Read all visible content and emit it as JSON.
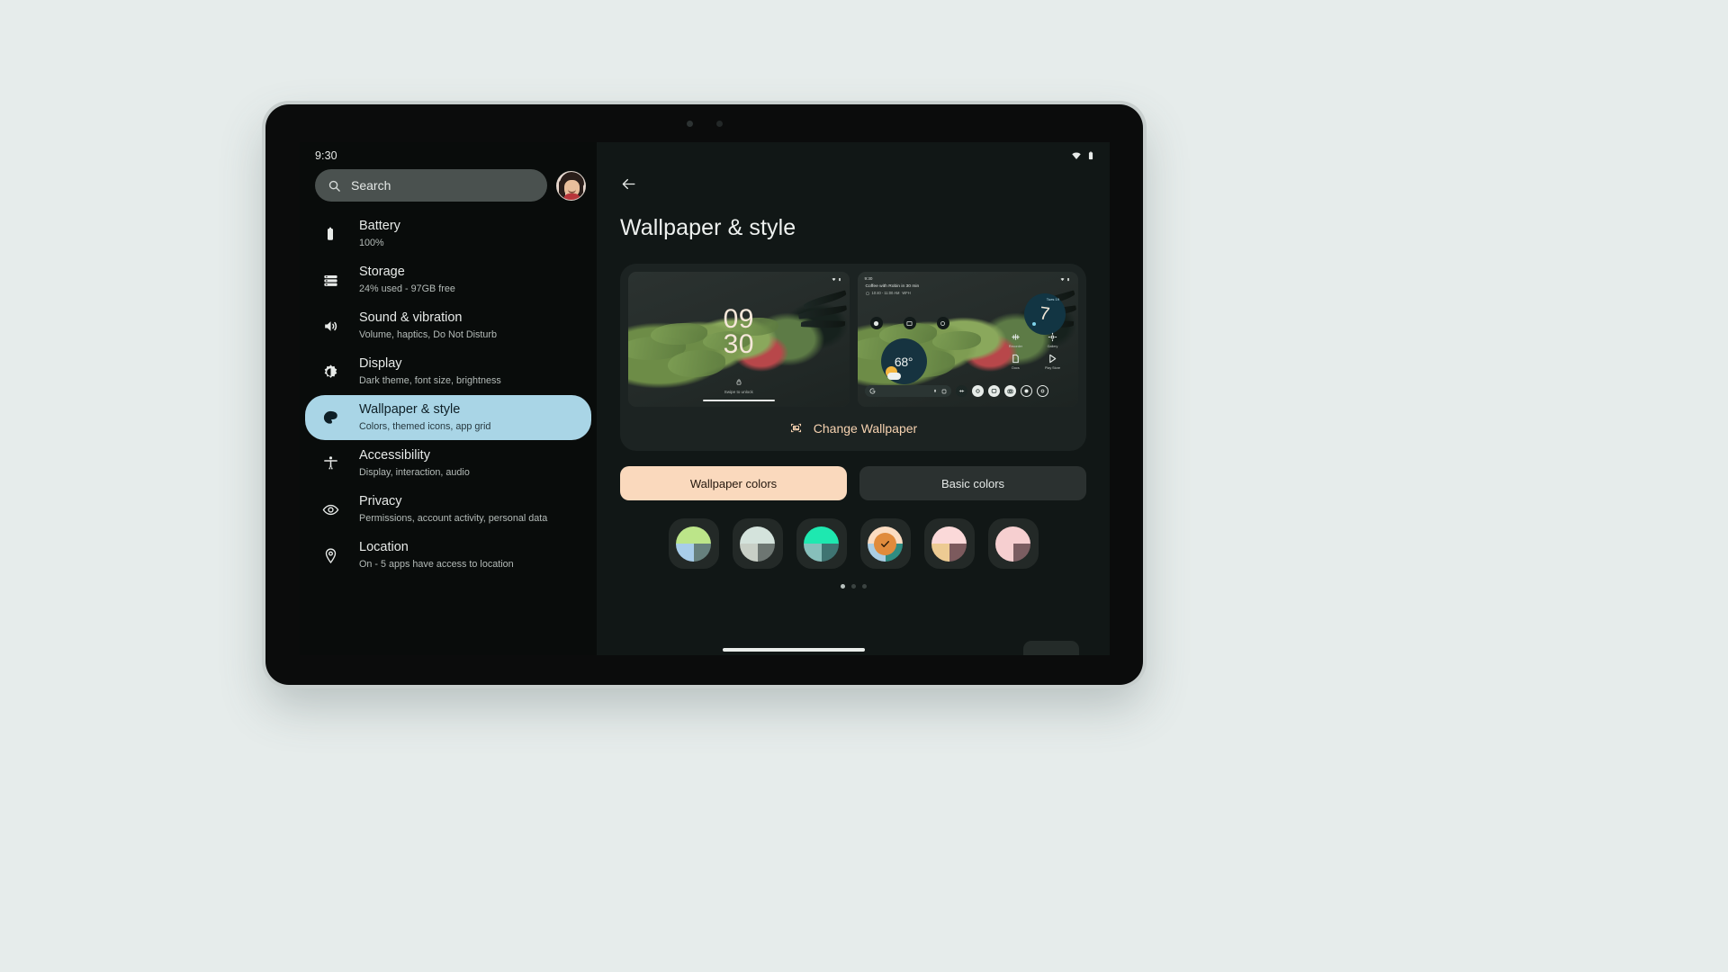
{
  "device": {
    "type": "tablet"
  },
  "status_bar": {
    "time": "9:30",
    "wifi_icon": "wifi-icon",
    "battery_icon": "battery-icon"
  },
  "sidebar": {
    "search": {
      "placeholder": "Search",
      "icon": "search-icon"
    },
    "avatar": {
      "name": "user-avatar"
    },
    "items": [
      {
        "icon": "battery-icon",
        "label": "Battery",
        "summary": "100%"
      },
      {
        "icon": "storage-icon",
        "label": "Storage",
        "summary": "24% used - 97GB free"
      },
      {
        "icon": "sound-icon",
        "label": "Sound & vibration",
        "summary": "Volume, haptics, Do Not Disturb"
      },
      {
        "icon": "brightness-icon",
        "label": "Display",
        "summary": "Dark theme, font size, brightness"
      },
      {
        "icon": "palette-icon",
        "label": "Wallpaper & style",
        "summary": "Colors, themed icons, app grid",
        "selected": true
      },
      {
        "icon": "accessibility-icon",
        "label": "Accessibility",
        "summary": "Display, interaction, audio"
      },
      {
        "icon": "privacy-icon",
        "label": "Privacy",
        "summary": "Permissions, account activity, personal data"
      },
      {
        "icon": "location-icon",
        "label": "Location",
        "summary": "On - 5 apps have access to location"
      }
    ]
  },
  "main": {
    "back_icon": "back-arrow-icon",
    "title": "Wallpaper & style",
    "previews": {
      "lock": {
        "name": "lock-screen-preview",
        "time_hh": "09",
        "time_mm": "30",
        "hint": "Swipe to unlock"
      },
      "home": {
        "name": "home-screen-preview",
        "clock": "9:30",
        "notification_title": "Coffee with Robin in 30 min",
        "notification_sub": "10:40 - 11:00 AM",
        "notification_sub2": "WFH",
        "weather_temp": "68°",
        "clock_widget_label": "Tues 19",
        "apps": [
          {
            "label": "Recorder",
            "icon": "recorder-icon"
          },
          {
            "label": "Gallery",
            "icon": "gallery-icon"
          },
          {
            "label": "Docs",
            "icon": "docs-icon"
          },
          {
            "label": "Play Store",
            "icon": "play-store-icon"
          }
        ],
        "dock_search_icon": "google-g-icon",
        "dock_mic_icon": "mic-icon",
        "dock_lens_icon": "lens-icon"
      }
    },
    "change_wallpaper": {
      "icon": "image-icon",
      "label": "Change Wallpaper"
    },
    "tabs": [
      {
        "label": "Wallpaper colors",
        "selected": true
      },
      {
        "label": "Basic colors",
        "selected": false
      }
    ],
    "swatches": [
      {
        "name": "swatch-lime",
        "selected": false,
        "colors": [
          "#bce589",
          "#a8cdea",
          "#66807d"
        ]
      },
      {
        "name": "swatch-sage",
        "selected": false,
        "colors": [
          "#d4e3dc",
          "#c8cfc6",
          "#6d7672"
        ]
      },
      {
        "name": "swatch-teal",
        "selected": false,
        "colors": [
          "#1ee8b0",
          "#87bfbb",
          "#3f7472"
        ]
      },
      {
        "name": "swatch-peach",
        "selected": true,
        "colors": [
          "#fbdcc1",
          "#a9cde4",
          "#2f8c82"
        ]
      },
      {
        "name": "swatch-blush",
        "selected": false,
        "colors": [
          "#fbd9d9",
          "#edcb93",
          "#7c5a5d"
        ]
      },
      {
        "name": "swatch-rose",
        "selected": false,
        "colors": [
          "#f6cfd0",
          "#f6cfd0",
          "#7b5d61"
        ]
      }
    ],
    "page_dots": {
      "count": 3,
      "active": 0
    },
    "selected_check_icon": "check-icon",
    "accent_color": "#f6d2b0",
    "selected_tab_color": "#fad9bd",
    "sidebar_selected_color": "#a9d5e6"
  }
}
